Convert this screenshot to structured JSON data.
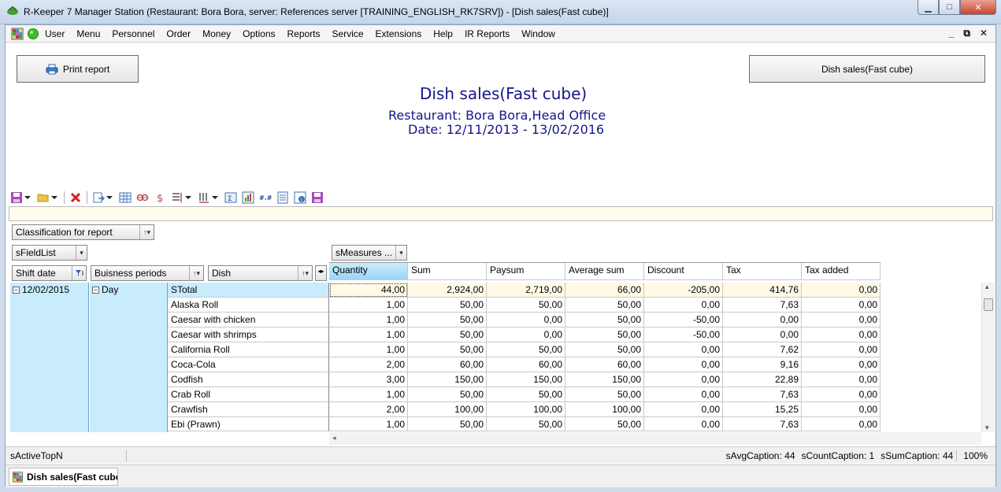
{
  "window": {
    "title": "R-Keeper 7 Manager Station (Restaurant: Bora Bora, server: References server [TRAINING_ENGLISH_RK7SRV]) - [Dish sales(Fast cube)]",
    "min_glyph": "▁",
    "max_glyph": "□",
    "close_glyph": "✕"
  },
  "menu": {
    "items": [
      "User",
      "Menu",
      "Personnel",
      "Order",
      "Money",
      "Options",
      "Reports",
      "Service",
      "Extensions",
      "Help",
      "IR Reports",
      "Window"
    ],
    "mdi_min": "_",
    "mdi_restore": "⧉",
    "mdi_close": "✕"
  },
  "report": {
    "print_label": "Print report",
    "report_name_btn": "Dish sales(Fast cube)",
    "title": "Dish sales(Fast cube)",
    "restaurant_line": "Restaurant: Bora Bora,Head Office",
    "date_line": "Date: 12/11/2013 - 13/02/2016"
  },
  "fields": {
    "classification": "Classification for report",
    "field_list": "sFieldList",
    "measures": "sMeasures ...",
    "shift_date": "Shift date",
    "business_periods": "Buisness periods",
    "dish": "Dish",
    "sort_glyph": "↑▾",
    "dropdown_glyph": "▾",
    "nav_glyph": "◂▸"
  },
  "grid": {
    "columns": [
      "Quantity",
      "Sum",
      "Paysum",
      "Average sum",
      "Discount",
      "Tax",
      "Tax added"
    ],
    "row_date": "12/02/2015",
    "row_period": "Day",
    "expand_glyph": "−",
    "rows": [
      {
        "dish": "STotal",
        "values": [
          "44,00",
          "2,924,00",
          "2,719,00",
          "66,00",
          "-205,00",
          "414,76",
          "0,00"
        ]
      },
      {
        "dish": "Alaska Roll",
        "values": [
          "1,00",
          "50,00",
          "50,00",
          "50,00",
          "0,00",
          "7,63",
          "0,00"
        ]
      },
      {
        "dish": "Caesar with chicken",
        "values": [
          "1,00",
          "50,00",
          "0,00",
          "50,00",
          "-50,00",
          "0,00",
          "0,00"
        ]
      },
      {
        "dish": "Caesar with shrimps",
        "values": [
          "1,00",
          "50,00",
          "0,00",
          "50,00",
          "-50,00",
          "0,00",
          "0,00"
        ]
      },
      {
        "dish": "California Roll",
        "values": [
          "1,00",
          "50,00",
          "50,00",
          "50,00",
          "0,00",
          "7,62",
          "0,00"
        ]
      },
      {
        "dish": "Coca-Cola",
        "values": [
          "2,00",
          "60,00",
          "60,00",
          "60,00",
          "0,00",
          "9,16",
          "0,00"
        ]
      },
      {
        "dish": "Codfish",
        "values": [
          "3,00",
          "150,00",
          "150,00",
          "150,00",
          "0,00",
          "22,89",
          "0,00"
        ]
      },
      {
        "dish": "Crab Roll",
        "values": [
          "1,00",
          "50,00",
          "50,00",
          "50,00",
          "0,00",
          "7,63",
          "0,00"
        ]
      },
      {
        "dish": "Crawfish",
        "values": [
          "2,00",
          "100,00",
          "100,00",
          "100,00",
          "0,00",
          "15,25",
          "0,00"
        ]
      },
      {
        "dish": "Ebi (Prawn)",
        "values": [
          "1,00",
          "50,00",
          "50,00",
          "50,00",
          "0,00",
          "7,63",
          "0,00"
        ]
      }
    ],
    "vscroll_up": "▴",
    "vscroll_down": "▾",
    "hscroll_left": "◂"
  },
  "status": {
    "left": "sActiveTopN",
    "avg": "sAvgCaption: 44",
    "count": "sCountCaption: 1",
    "sum": "sSumCaption: 44",
    "zoom": "100%"
  },
  "taskbar": {
    "tab_label": "Dish sales(Fast cube)"
  },
  "colors": {
    "title_blue": "#16168a",
    "row_header_bg": "#c8ecfb",
    "total_row_bg": "#fffae6",
    "close_red": "#c9442c"
  }
}
